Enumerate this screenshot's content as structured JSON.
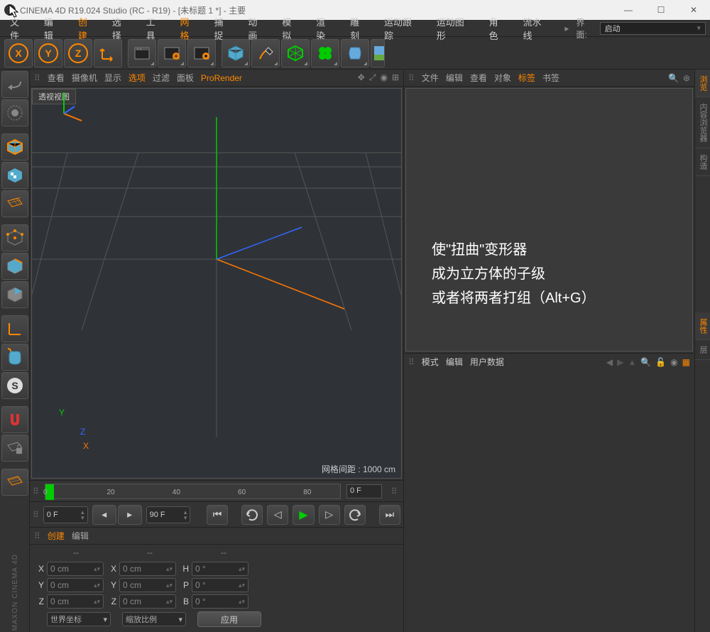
{
  "title": "CINEMA 4D R19.024 Studio (RC - R19) - [未标题 1 *] - 主要",
  "menu": [
    "文件",
    "编辑",
    "创建",
    "选择",
    "工具",
    "网格",
    "捕捉",
    "动画",
    "模拟",
    "渲染",
    "雕刻",
    "运动跟踪",
    "运动图形",
    "角色",
    "流水线"
  ],
  "menu_orange_idx": [
    2,
    5
  ],
  "layout_label": "界面:",
  "layout_value": "启动",
  "viewport_menu": [
    "查看",
    "摄像机",
    "显示",
    "选项",
    "过滤",
    "面板",
    "ProRender"
  ],
  "viewport_menu_orange_idx": [
    3,
    6
  ],
  "viewport_tab": "透视视图",
  "viewport_status": "网格间距 : 1000 cm",
  "axis": {
    "x": "X",
    "y": "Y",
    "z": "Z"
  },
  "timeline": {
    "marks": [
      "0",
      "20",
      "40",
      "60",
      "80"
    ],
    "current": "0 F"
  },
  "transport": {
    "start": "0 F",
    "end": "90 F"
  },
  "material_menu": [
    "创建",
    "编辑"
  ],
  "coord": {
    "rows": [
      {
        "a": "X",
        "av": "0 cm",
        "b": "X",
        "bv": "0 cm",
        "c": "H",
        "cv": "0 °"
      },
      {
        "a": "Y",
        "av": "0 cm",
        "b": "Y",
        "bv": "0 cm",
        "c": "P",
        "cv": "0 °"
      },
      {
        "a": "Z",
        "av": "0 cm",
        "b": "Z",
        "bv": "0 cm",
        "c": "B",
        "cv": "0 °"
      }
    ],
    "mode1": "世界坐标",
    "mode2": "缩放比例",
    "apply": "应用"
  },
  "obj_menu": [
    "文件",
    "编辑",
    "查看",
    "对象",
    "标签",
    "书签"
  ],
  "obj_menu_orange_idx": [
    4
  ],
  "annot_lines": [
    "使\"扭曲\"变形器",
    "成为立方体的子级",
    "或者将两者打组（Alt+G）"
  ],
  "attr_menu": [
    "模式",
    "编辑",
    "用户数据"
  ],
  "rtabs": [
    "浏览",
    "内容浏览器",
    "构造"
  ],
  "rtabs2": [
    "属性",
    "层"
  ],
  "maxon": "MAXON CINEMA 4D"
}
